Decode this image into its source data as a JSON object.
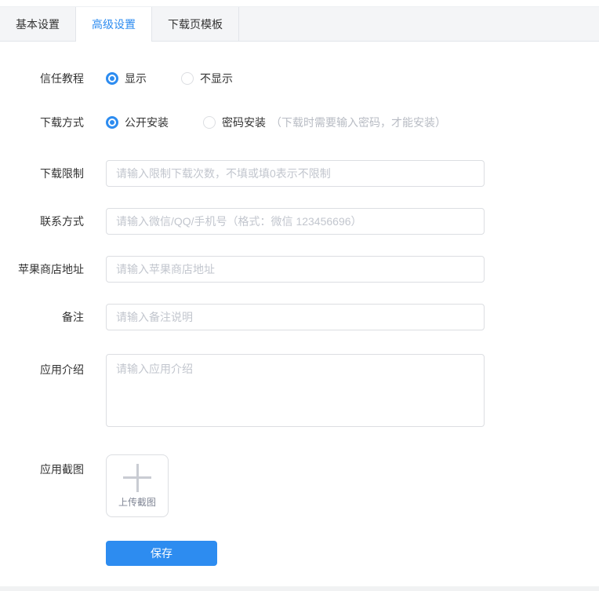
{
  "tabs": [
    {
      "label": "基本设置",
      "active": false
    },
    {
      "label": "高级设置",
      "active": true
    },
    {
      "label": "下载页模板",
      "active": false
    }
  ],
  "form": {
    "trust_tutorial": {
      "label": "信任教程",
      "options": [
        {
          "label": "显示",
          "selected": true
        },
        {
          "label": "不显示",
          "selected": false
        }
      ]
    },
    "download_method": {
      "label": "下载方式",
      "options": [
        {
          "label": "公开安装",
          "selected": true
        },
        {
          "label": "密码安装",
          "selected": false,
          "hint": "（下载时需要输入密码，才能安装）"
        }
      ]
    },
    "download_limit": {
      "label": "下载限制",
      "placeholder": "请输入限制下载次数，不填或填0表示不限制",
      "value": ""
    },
    "contact": {
      "label": "联系方式",
      "placeholder": "请输入微信/QQ/手机号（格式：微信 123456696）",
      "value": ""
    },
    "app_store_url": {
      "label": "苹果商店地址",
      "placeholder": "请输入苹果商店地址",
      "value": ""
    },
    "remark": {
      "label": "备注",
      "placeholder": "请输入备注说明",
      "value": ""
    },
    "app_intro": {
      "label": "应用介绍",
      "placeholder": "请输入应用介绍",
      "value": ""
    },
    "app_screenshot": {
      "label": "应用截图",
      "upload_label": "上传截图"
    },
    "save_label": "保存"
  },
  "icons": {
    "plus_upload": "plus-icon"
  },
  "colors": {
    "accent": "#2d8cf0",
    "tab_bar_bg": "#f4f5f7",
    "border": "#dcdee2",
    "placeholder": "#c2c6ce"
  }
}
